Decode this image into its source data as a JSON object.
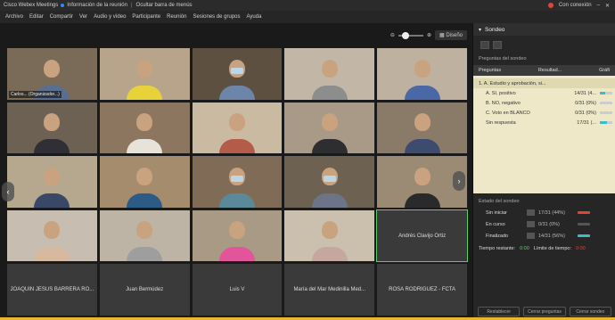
{
  "titlebar": {
    "app_title": "Cisco Webex Meetings",
    "meeting_info": "Información de la reunión",
    "hide_bar": "Ocultar barra de menús",
    "connection_status": "Con conexión"
  },
  "menu": [
    "Archivo",
    "Editar",
    "Compartir",
    "Ver",
    "Audio y vídeo",
    "Participante",
    "Reunión",
    "Sesiones de grupos",
    "Ayuda"
  ],
  "view": {
    "layout_button": "Diseño"
  },
  "participants": [
    {
      "label": "Carlos... (Organizador...)",
      "bg": "#7a6a58",
      "shirt": "#5a6f8f"
    },
    {
      "label": "",
      "bg": "#b7a48a",
      "shirt": "#e7d23a"
    },
    {
      "label": "",
      "bg": "#5d5040",
      "shirt": "#6c85a8",
      "mask": true
    },
    {
      "label": "",
      "bg": "#c2b7a7",
      "shirt": "#8d8d8d"
    },
    {
      "label": "",
      "bg": "#bfb1a0",
      "shirt": "#4a67a6"
    },
    {
      "label": "",
      "bg": "#6d6153",
      "shirt": "#2f2f35"
    },
    {
      "label": "",
      "bg": "#8d7660",
      "shirt": "#e8e3d9"
    },
    {
      "label": "",
      "bg": "#cbbaa2",
      "shirt": "#b45b4a"
    },
    {
      "label": "",
      "bg": "#a89a86",
      "shirt": "#2e2e30"
    },
    {
      "label": "",
      "bg": "#8a7a68",
      "shirt": "#3c4b6e"
    },
    {
      "label": "",
      "bg": "#b5a88f",
      "shirt": "#3b4766"
    },
    {
      "label": "",
      "bg": "#a58c6c",
      "shirt": "#2c5b86"
    },
    {
      "label": "",
      "bg": "#806c56",
      "shirt": "#5a8a9a",
      "mask": true
    },
    {
      "label": "",
      "bg": "#6d6152",
      "shirt": "#6d7488",
      "mask": true
    },
    {
      "label": "",
      "bg": "#9c8b74",
      "shirt": "#2a2a2d"
    },
    {
      "label": "",
      "bg": "#c7bdb0",
      "shirt": "#d7b9a0"
    },
    {
      "label": "",
      "bg": "#bdb4a6",
      "shirt": "#9e9e9e"
    },
    {
      "label": "",
      "bg": "#a89a84",
      "shirt": "#e2559a"
    },
    {
      "label": "",
      "bg": "#cbbfae",
      "shirt": "#c6a7a0"
    }
  ],
  "name_tiles": [
    "Andrés Clavijo Ortiz",
    "JOAQUIN JESUS BARRERA RO...",
    "Juan Bermúdez",
    "Luis V",
    "María del Mar Medinilla Med...",
    "ROSA RODRIGUEZ - FCTA"
  ],
  "panel": {
    "title": "Sondeo",
    "subtitle": "Preguntas del sondeo",
    "col_questions": "Preguntas",
    "col_results": "Resultad...",
    "col_graph": "Gráfi",
    "question": "1. A. Estudio y aprobación, si...",
    "answers": [
      {
        "label": "A.  SI, positivo",
        "value": "14/31 (4...",
        "fill": 0.45
      },
      {
        "label": "B.  NO, negativo",
        "value": "0/31 (0%)",
        "fill": 0.0
      },
      {
        "label": "C.  Voto en BLANCO",
        "value": "0/31 (0%)",
        "fill": 0.0
      },
      {
        "label": "Sin respuesta",
        "value": "17/31 (...",
        "fill": 0.55
      }
    ],
    "status_title": "Estado del sondeo",
    "status": [
      {
        "label": "Sin iniciar",
        "value": "17/31 (44%)",
        "color": "#e0443a"
      },
      {
        "label": "En curso",
        "value": "0/31 (0%)",
        "color": "#555555"
      },
      {
        "label": "Finalizado",
        "value": "14/31 (56%)",
        "color": "#3fb8c8"
      }
    ],
    "remaining_label": "Tiempo restante:",
    "remaining_value": "0:00",
    "limit_label": "Límite de tiempo:",
    "limit_value": "0:00",
    "buttons": [
      "Restablecer",
      "Cerrar preguntas",
      "Cerrar sondeo"
    ]
  },
  "colors": {
    "accent": "#2d8cff",
    "highlight_stripe": "#e8b828",
    "green": "#5fd065",
    "red": "#e0443a"
  }
}
